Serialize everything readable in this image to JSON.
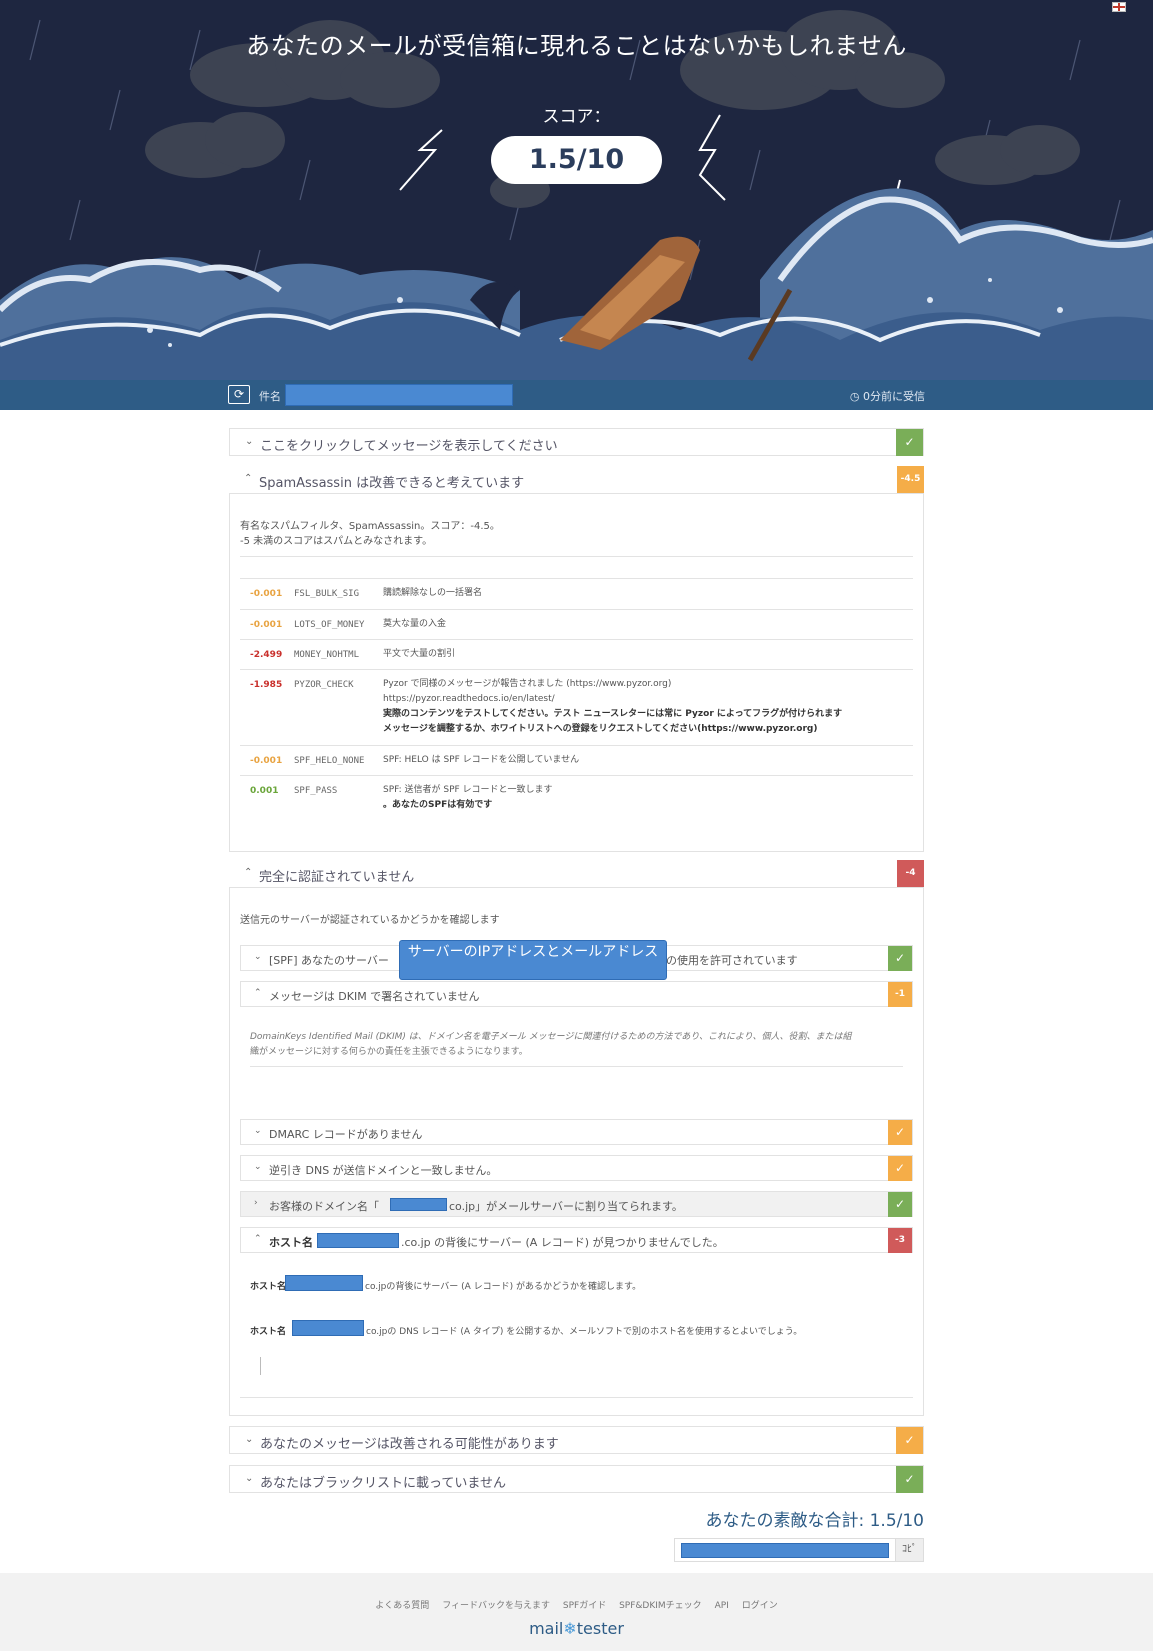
{
  "hero": {
    "title": "あなたのメールが受信箱に現れることはないかもしれません",
    "score_label": "スコア：",
    "score": "1.5/10"
  },
  "infobar": {
    "subject_label": "件名",
    "received": "0分前に受信"
  },
  "sections": {
    "view_message": {
      "title": "ここをクリックしてメッセージを表示してください"
    },
    "spamassassin": {
      "title": "SpamAssassin は改善できると考えています",
      "badge": "-4.5",
      "intro_line1": "有名なスパムフィルタ、SpamAssassin。スコア：-4.5。",
      "intro_line2": "-5 未満のスコアはスパムとみなされます。",
      "rules": [
        {
          "score": "-0.001",
          "name": "FSL_BULK_SIG",
          "desc": "購読解除なしの一括署名",
          "desc2": "",
          "desc3": "",
          "desc4": ""
        },
        {
          "score": "-0.001",
          "name": "LOTS_OF_MONEY",
          "desc": "莫大な量の入金",
          "desc2": "",
          "desc3": "",
          "desc4": ""
        },
        {
          "score": "-2.499",
          "name": "MONEY_NOHTML",
          "desc": "平文で大量の割引",
          "desc2": "",
          "desc3": "",
          "desc4": ""
        },
        {
          "score": "-1.985",
          "name": "PYZOR_CHECK",
          "desc": "Pyzor で同様のメッセージが報告されました (https://www.pyzor.org)",
          "desc2": "https://pyzor.readthedocs.io/en/latest/",
          "desc3": "実際のコンテンツをテストしてください。テスト ニュースレターには常に Pyzor によってフラグが付けられます",
          "desc4": "メッセージを調整するか、ホワイトリストへの登録をリクエストしてください(https://www.pyzor.org)"
        },
        {
          "score": "-0.001",
          "name": "SPF_HELO_NONE",
          "desc": "SPF: HELO は SPF レコードを公開していません",
          "desc2": "",
          "desc3": "",
          "desc4": ""
        },
        {
          "score": "0.001",
          "name": "SPF_PASS",
          "desc": "SPF: 送信者が SPF レコードと一致します",
          "desc2": "",
          "desc3": "。あなたのSPFは有効です",
          "desc4": ""
        }
      ]
    },
    "auth": {
      "title": "完全に認証されていません",
      "badge": "-4",
      "intro": "送信元のサーバーが認証されているかどうかを確認します",
      "spf": {
        "title": "[SPF] あなたのサーバー",
        "title_end": "の使用を許可されています"
      },
      "dkim": {
        "title": "メッセージは DKIM で署名されていません",
        "badge": "-1",
        "body_line1": "DomainKeys Identified Mail (DKIM) は、ドメイン名を電子メール メッセージに関連付けるための方法であり、これにより、個人、役割、または組",
        "body_line2": "織がメッセージに対する何らかの責任を主張できるようになります。"
      },
      "dmarc": {
        "title": "DMARC レコードがありません"
      },
      "rdns": {
        "title": "逆引き DNS が送信ドメインと一致しません。"
      },
      "domain": {
        "title_start": "お客様のドメイン名「",
        "title_end": "co.jp」がメールサーバーに割り当てられます。"
      },
      "host": {
        "title_start": "ホスト名",
        "title_end": ".co.jp の背後にサーバー (A レコード) が見つかりませんでした。",
        "badge": "-3",
        "line1_start": "ホスト名",
        "line1_end": "co.jpの背後にサーバー (A レコード) があるかどうかを確認します。",
        "line2_start": "ホスト名",
        "line2_end": "co.jpの DNS レコード (A タイプ) を公開するか、メールソフトで別のホスト名を使用するとよいでしょう。"
      }
    },
    "shortened": {
      "title": "あなたのメッセージは改善される可能性があります"
    },
    "blacklist": {
      "title": "あなたはブラックリストに載っていません"
    }
  },
  "tooltip": "サーバーのIPアドレスとメールアドレス",
  "total": "あなたの素敵な合計: 1.5/10",
  "copy_label": "ｺﾋﾟ",
  "footer": {
    "links": [
      "よくある質問",
      "フィードバックを与えます",
      "SPFガイド",
      "SPF&DKIMチェック",
      "API",
      "ログイン"
    ],
    "logo_a": "mail",
    "logo_b": "tester"
  },
  "colors": {
    "hero_bg": "#1e2640",
    "bar": "#2e5c86",
    "ok": "#7aae58",
    "warn": "#f5ad48",
    "bad": "#d05a5a",
    "redact": "#4a89d2"
  },
  "icons": [
    "refresh-icon",
    "clock-icon",
    "check-icon",
    "chevron-down-icon",
    "chevron-up-icon",
    "snowflake-icon",
    "flag-icon"
  ]
}
